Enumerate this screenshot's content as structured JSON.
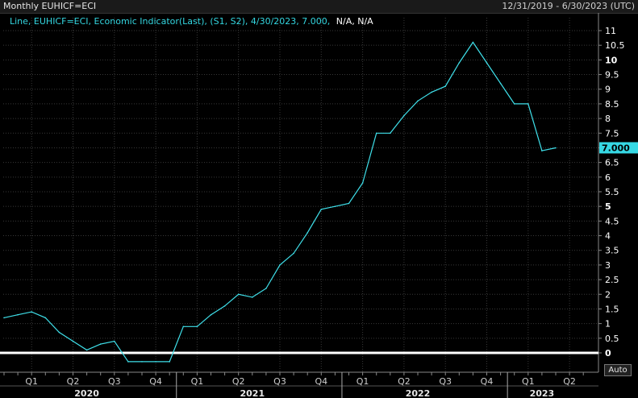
{
  "header": {
    "title": "Monthly EUHICF=ECI",
    "date_range": "12/31/2019 - 6/30/2023 (UTC)"
  },
  "legend": {
    "text": "Line, EUHICF=ECI, Economic Indicator(Last), (S1, S2), 4/30/2023, 7.000,",
    "na": "N/A, N/A"
  },
  "controls": {
    "auto_label": "Auto"
  },
  "colors": {
    "series": "#3fe0ea",
    "background": "#000000",
    "zero_line": "#ffffff"
  },
  "chart_data": {
    "type": "line",
    "x_start": "2019-12",
    "x_end": "2023-06",
    "ylim": [
      -0.5,
      11
    ],
    "y_ticks": [
      "0",
      "0.5",
      "1",
      "1.5",
      "2",
      "2.5",
      "3",
      "3.5",
      "4",
      "4.5",
      "5",
      "5.5",
      "6",
      "6.5",
      "7",
      "7.5",
      "8",
      "8.5",
      "9",
      "9.5",
      "10",
      "10.5",
      "11"
    ],
    "bold_ticks": [
      "0",
      "5",
      "10"
    ],
    "x_quarters": [
      {
        "label": "Q1",
        "date": "2020-02"
      },
      {
        "label": "Q2",
        "date": "2020-05"
      },
      {
        "label": "Q3",
        "date": "2020-08"
      },
      {
        "label": "Q4",
        "date": "2020-11"
      },
      {
        "label": "Q1",
        "date": "2021-02"
      },
      {
        "label": "Q2",
        "date": "2021-05"
      },
      {
        "label": "Q3",
        "date": "2021-08"
      },
      {
        "label": "Q4",
        "date": "2021-11"
      },
      {
        "label": "Q1",
        "date": "2022-02"
      },
      {
        "label": "Q2",
        "date": "2022-05"
      },
      {
        "label": "Q3",
        "date": "2022-08"
      },
      {
        "label": "Q4",
        "date": "2022-11"
      },
      {
        "label": "Q1",
        "date": "2023-02"
      },
      {
        "label": "Q2",
        "date": "2023-05"
      }
    ],
    "x_years": [
      {
        "label": "2020",
        "date": "2020-06"
      },
      {
        "label": "2021",
        "date": "2021-06"
      },
      {
        "label": "2022",
        "date": "2022-06"
      },
      {
        "label": "2023",
        "date": "2023-03"
      }
    ],
    "x_year_starts": [
      "2021-01",
      "2022-01",
      "2023-01"
    ],
    "series": [
      {
        "x": [
          "2019-12",
          "2020-01",
          "2020-02",
          "2020-03",
          "2020-04",
          "2020-05",
          "2020-06",
          "2020-07",
          "2020-08",
          "2020-09",
          "2020-10",
          "2020-11",
          "2020-12",
          "2021-01",
          "2021-02",
          "2021-03",
          "2021-04",
          "2021-05",
          "2021-06",
          "2021-07",
          "2021-08",
          "2021-09",
          "2021-10",
          "2021-11",
          "2021-12",
          "2022-01",
          "2022-02",
          "2022-03",
          "2022-04",
          "2022-05",
          "2022-06",
          "2022-07",
          "2022-08",
          "2022-09",
          "2022-10",
          "2022-11",
          "2022-12",
          "2023-01",
          "2023-02",
          "2023-03",
          "2023-04"
        ],
        "values": [
          1.2,
          1.3,
          1.4,
          1.2,
          0.7,
          0.4,
          0.1,
          0.3,
          0.4,
          -0.3,
          -0.3,
          -0.3,
          -0.3,
          0.9,
          0.9,
          1.3,
          1.6,
          2.0,
          1.9,
          2.2,
          3.0,
          3.4,
          4.1,
          4.9,
          5.0,
          5.1,
          5.8,
          7.5,
          7.5,
          8.1,
          8.6,
          8.9,
          9.1,
          9.9,
          10.6,
          9.9,
          9.2,
          8.5,
          8.5,
          6.9,
          7.0
        ]
      }
    ],
    "last_value": "7.000"
  }
}
